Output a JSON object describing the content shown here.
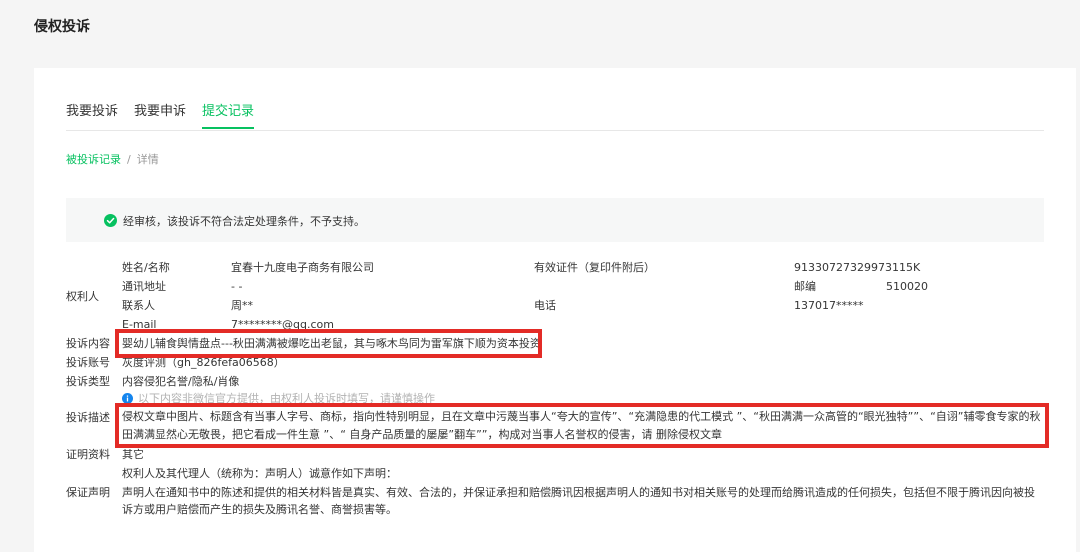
{
  "page": {
    "title": "侵权投诉"
  },
  "tabs": [
    {
      "label": "我要投诉"
    },
    {
      "label": "我要申诉"
    },
    {
      "label": "提交记录"
    }
  ],
  "breadcrumb": {
    "parent": "被投诉记录",
    "separator": "/",
    "current": "详情"
  },
  "notice": {
    "text": "经审核，该投诉不符合法定处理条件，不予支持。",
    "status_color": "#07c160"
  },
  "right_holder": {
    "section_label": "权利人",
    "name_label": "姓名/名称",
    "name_value": "宜春十九度电子商务有限公司",
    "cert_label": "有效证件（复印件附后）",
    "cert_value": "91330727329973115K",
    "address_label": "通讯地址",
    "address_value": "- -",
    "postcode_label": "邮编",
    "postcode_value": "510020",
    "contact_label": "联系人",
    "contact_value": "周**",
    "phone_label": "电话",
    "phone_value": "137017*****",
    "email_label": "E-mail",
    "email_value": "7********@qq.com"
  },
  "complaint": {
    "content_label": "投诉内容",
    "content_value": "婴幼儿辅食舆情盘点---秋田满满被爆吃出老鼠，其与啄木鸟同为雷军旗下顺为资本投资",
    "account_label": "投诉账号",
    "account_value": "灰度评测（gh_826fefa06568）",
    "type_label": "投诉类型",
    "type_value": "内容侵犯名誉/隐私/肖像",
    "type_note": "以下内容非微信官方提供，由权利人投诉时填写，请谨慎操作",
    "desc_label": "投诉描述",
    "desc_value": "侵权文章中图片、标题含有当事人字号、商标，指向性特别明显，且在文章中污蔑当事人“夸大的宣传”、“充满隐患的代工模式 ”、“秋田满满一众高管的“眼光独特””、“自诩”辅零食专家的秋田满满显然心无敬畏，把它看成一件生意 ”、“ 自身产品质量的屡屡”翻车””，构成对当事人名誉权的侵害，请 删除侵权文章",
    "proof_label": "证明资料",
    "proof_value": "其它",
    "guarantee_label": "保证声明",
    "guarantee_intro": "权利人及其代理人（统称为：声明人）诚意作如下声明：",
    "guarantee_value": "声明人在通知书中的陈述和提供的相关材料皆是真实、有效、合法的，并保证承担和赔偿腾讯因根据声明人的通知书对相关账号的处理而给腾讯造成的任何损失，包括但不限于腾讯因向被投诉方或用户赔偿而产生的损失及腾讯名誉、商誉损害等。"
  },
  "colors": {
    "accent": "#07c160",
    "highlight_box": "#e32b26",
    "info": "#1485ee"
  }
}
